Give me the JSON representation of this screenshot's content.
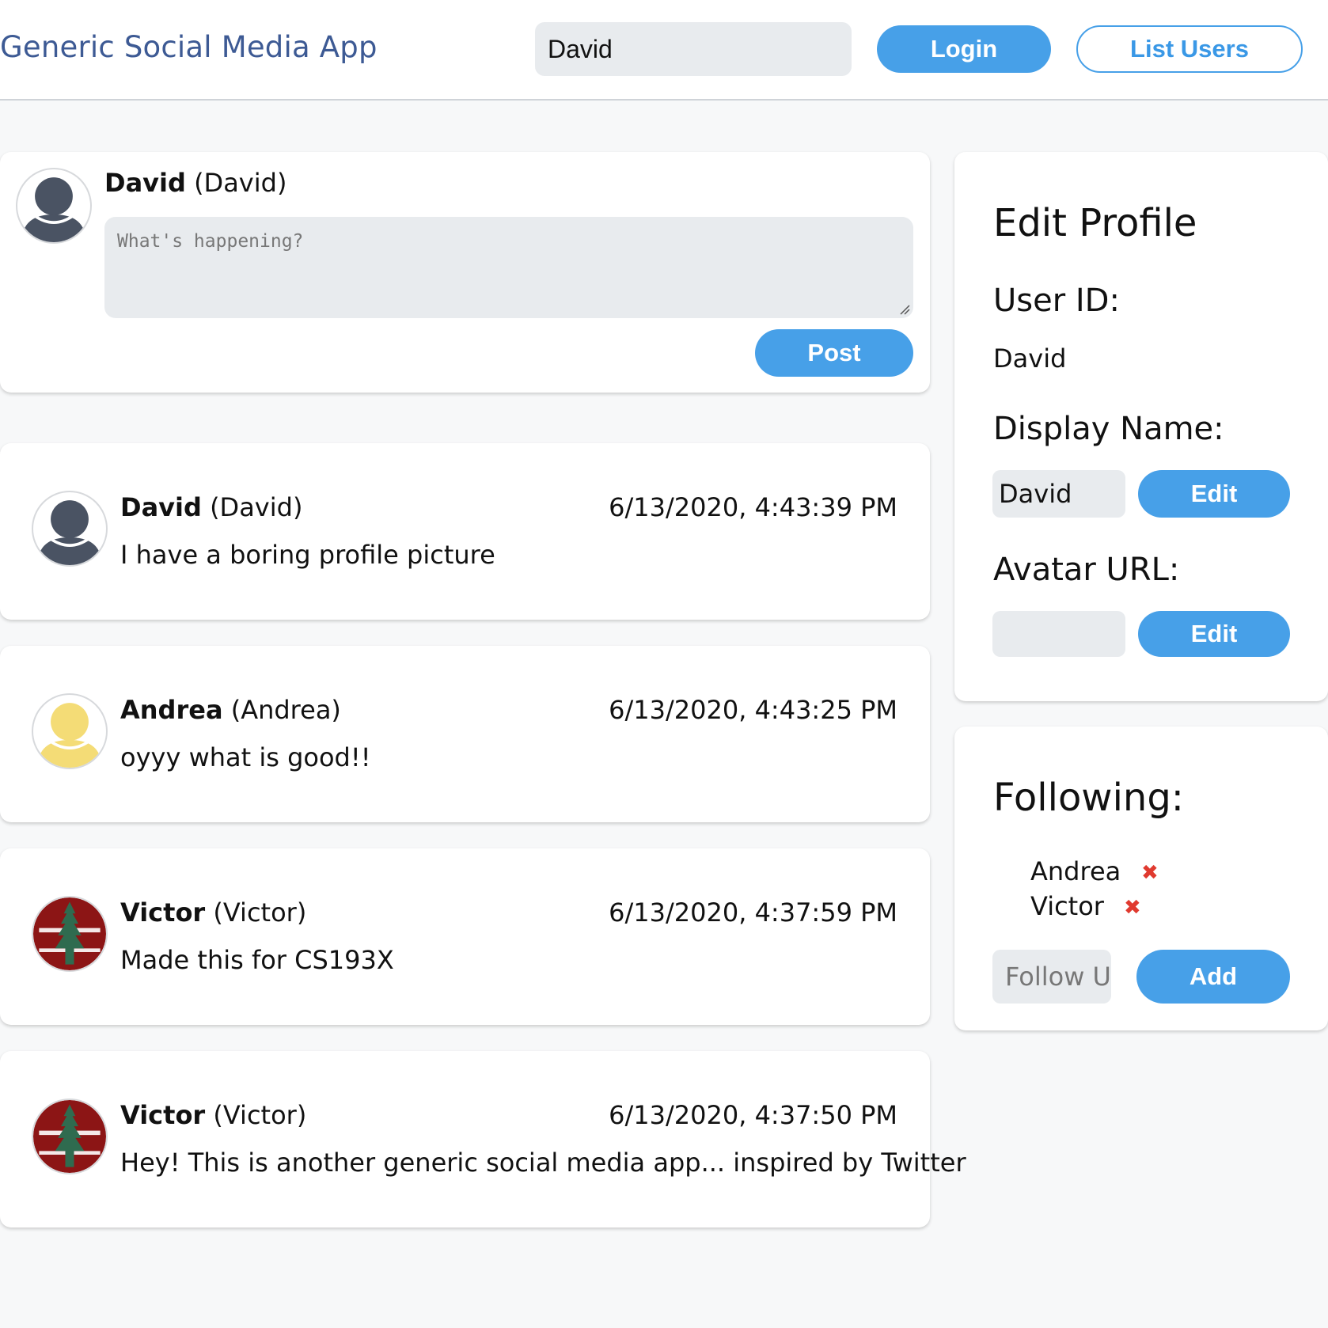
{
  "header": {
    "title": "Generic Social Media App",
    "login_value": "David",
    "login_button": "Login",
    "list_users_button": "List Users"
  },
  "composer": {
    "display_name": "David",
    "user_id": "(David)",
    "placeholder": "What's happening?",
    "post_button": "Post"
  },
  "posts": [
    {
      "display_name": "David",
      "user_id": "(David)",
      "time": "6/13/2020, 4:43:39 PM",
      "text": "I have a boring profile picture",
      "avatar": "default-avatar"
    },
    {
      "display_name": "Andrea",
      "user_id": "(Andrea)",
      "time": "6/13/2020, 4:43:25 PM",
      "text": "oyyy what is good!!",
      "avatar": "yellow-avatar"
    },
    {
      "display_name": "Victor",
      "user_id": "(Victor)",
      "time": "6/13/2020, 4:37:59 PM",
      "text": "Made this for CS193X",
      "avatar": "stanford-tree-logo"
    },
    {
      "display_name": "Victor",
      "user_id": "(Victor)",
      "time": "6/13/2020, 4:37:50 PM",
      "text": "Hey! This is another generic social media app... inspired by Twitter",
      "avatar": "stanford-tree-logo"
    }
  ],
  "edit_profile": {
    "heading": "Edit Profile",
    "user_id_label": "User ID:",
    "user_id_value": "David",
    "display_name_label": "Display Name:",
    "display_name_value": "David",
    "display_name_button": "Edit",
    "avatar_url_label": "Avatar URL:",
    "avatar_url_value": "",
    "avatar_url_button": "Edit"
  },
  "following": {
    "heading": "Following:",
    "users": [
      "Andrea",
      "Victor"
    ],
    "remove_glyph": "✖",
    "follow_placeholder": "Follow User",
    "add_button": "Add"
  },
  "colors": {
    "accent": "#47a0e8",
    "brand": "#3d5a94",
    "remove": "#e03a2f",
    "input_bg": "#e8ebee"
  }
}
